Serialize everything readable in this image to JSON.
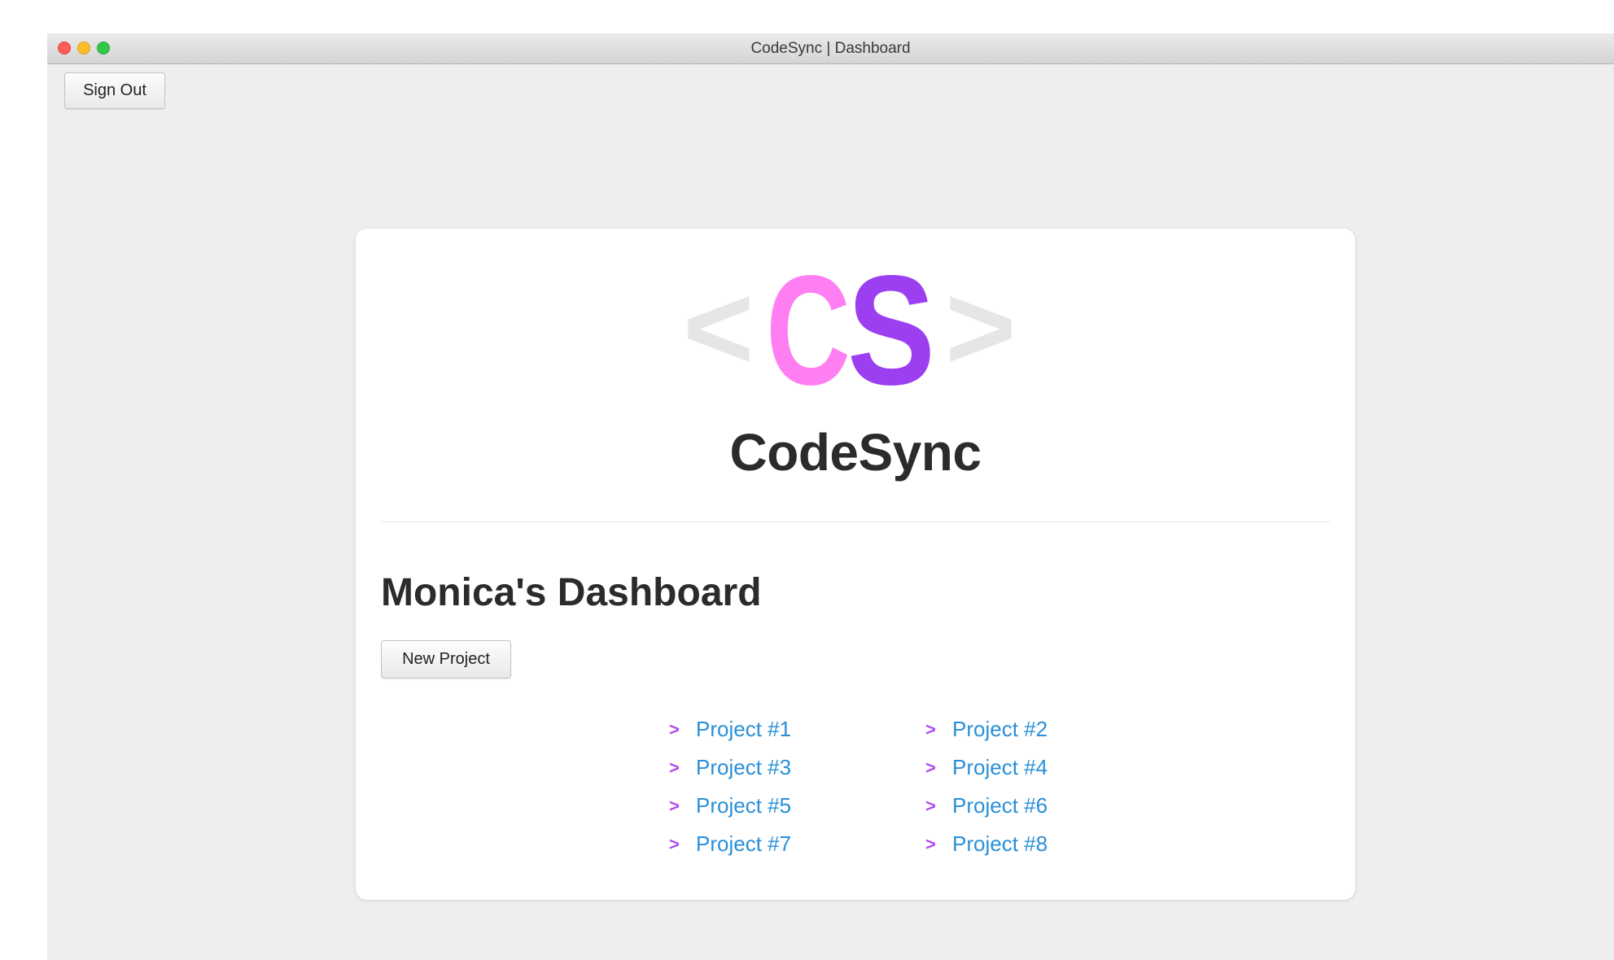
{
  "window": {
    "title": "CodeSync | Dashboard"
  },
  "toolbar": {
    "sign_out_label": "Sign Out"
  },
  "logo": {
    "left_bracket": "<",
    "letter_c": "C",
    "letter_s": "S",
    "right_bracket": ">",
    "colors": {
      "bracket": "#e6e6e6",
      "c": "#ff7ef2",
      "s": "#9b3ff0"
    }
  },
  "brand": {
    "name": "CodeSync"
  },
  "dashboard": {
    "title": "Monica's Dashboard",
    "new_project_label": "New Project",
    "projects": [
      {
        "marker": ">",
        "label": "Project #1"
      },
      {
        "marker": ">",
        "label": "Project #2"
      },
      {
        "marker": ">",
        "label": "Project #3"
      },
      {
        "marker": ">",
        "label": "Project #4"
      },
      {
        "marker": ">",
        "label": "Project #5"
      },
      {
        "marker": ">",
        "label": "Project #6"
      },
      {
        "marker": ">",
        "label": "Project #7"
      },
      {
        "marker": ">",
        "label": "Project #8"
      }
    ]
  },
  "colors": {
    "link": "#2a8fd8",
    "marker": "#b04cf0",
    "window_bg": "#eeeeee",
    "card_bg": "#ffffff"
  }
}
